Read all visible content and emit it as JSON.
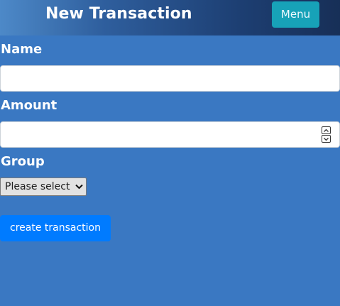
{
  "header": {
    "title": "New Transaction",
    "menu_label": "Menu"
  },
  "form": {
    "name": {
      "label": "Name",
      "value": ""
    },
    "amount": {
      "label": "Amount",
      "value": ""
    },
    "group": {
      "label": "Group",
      "selected": "Please select"
    },
    "submit_label": "create transaction"
  },
  "colors": {
    "background": "#3a78c2",
    "menu_button": "#17a2b8",
    "primary_button": "#007bff",
    "header_gradient_end": "#172f57"
  },
  "icons": {
    "select_arrow": "chevron-down-icon",
    "spinner_up": "chevron-up-icon",
    "spinner_down": "chevron-down-icon"
  }
}
